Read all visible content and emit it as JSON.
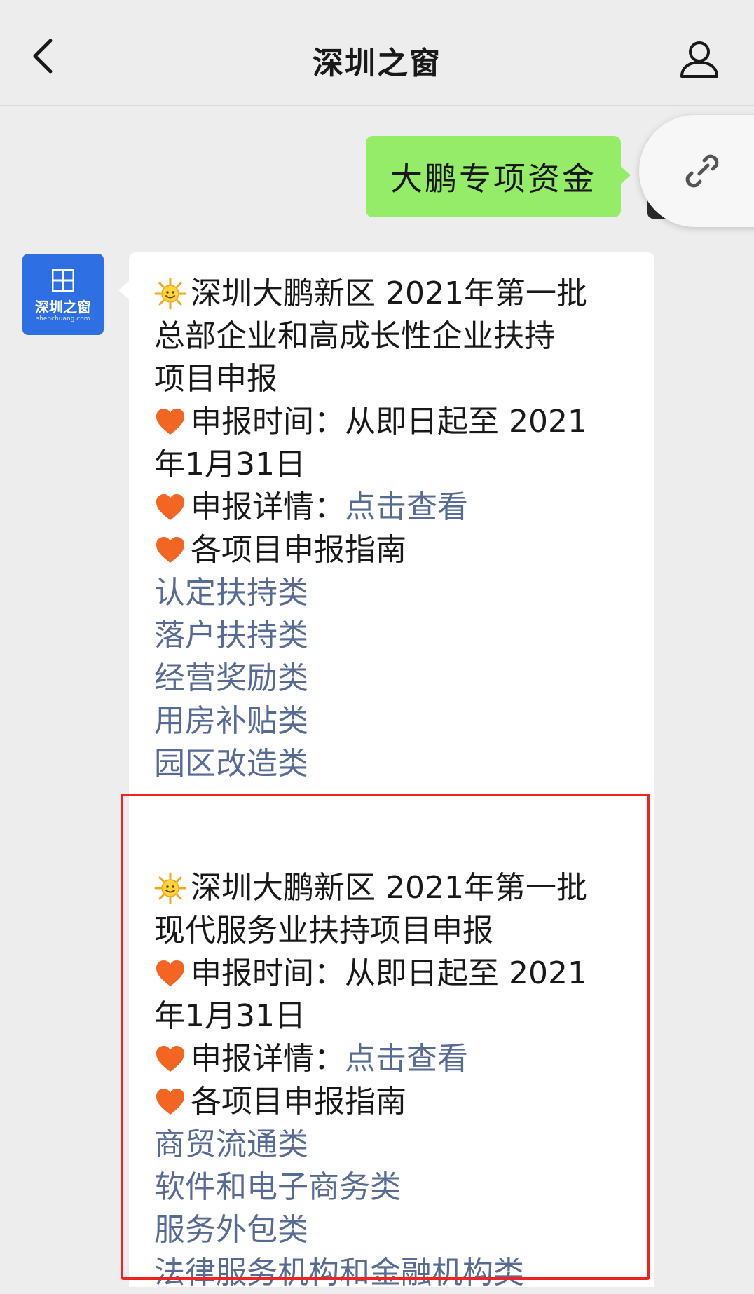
{
  "header": {
    "title": "深圳之窗"
  },
  "sent_message": {
    "text": "大鹏专项资金"
  },
  "account_avatar": {
    "text": "深圳之窗",
    "subtext": "shenchuang.com"
  },
  "reply": {
    "section1": {
      "title_line1": "深圳大鹏新区 2021年第一批",
      "title_line2": "总部企业和高成长性企业扶持",
      "title_line3": "项目申报",
      "time_line1": "申报时间：从即日起至 2021",
      "time_line2": "年1月31日",
      "detail_label": "申报详情：",
      "detail_link": "点击查看",
      "guide_title": "各项目申报指南",
      "guide_links": [
        "认定扶持类",
        "落户扶持类",
        "经营奖励类",
        "用房补贴类",
        "园区改造类"
      ]
    },
    "section2": {
      "title_line1": "深圳大鹏新区 2021年第一批",
      "title_line2": "现代服务业扶持项目申报",
      "time_line1": "申报时间：从即日起至 2021",
      "time_line2": "年1月31日",
      "detail_label": "申报详情：",
      "detail_link": "点击查看",
      "guide_title": "各项目申报指南",
      "guide_links": [
        "商贸流通类",
        "软件和电子商务类",
        "服务外包类",
        "法律服务机构和金融机构类"
      ]
    }
  },
  "colors": {
    "bubble_sent": "#95ec69",
    "link": "#576b95",
    "highlight": "#f02323",
    "avatar_bg": "#2f6fe4"
  }
}
